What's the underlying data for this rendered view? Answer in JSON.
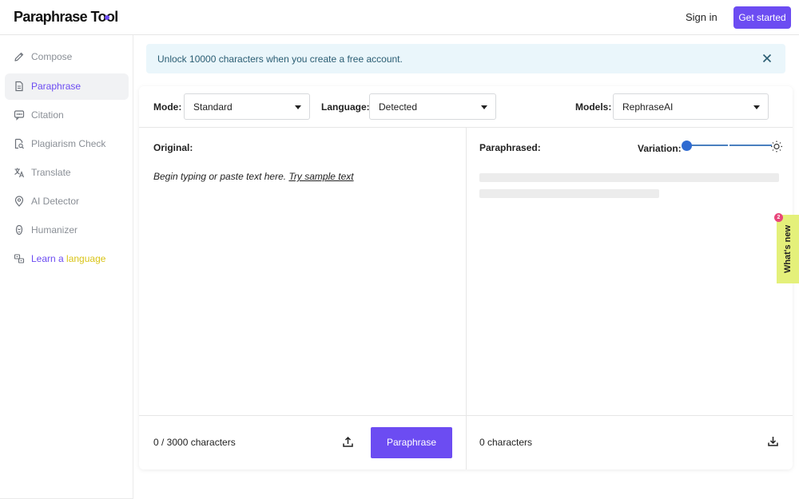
{
  "header": {
    "logo": "Paraphrase Tool",
    "sign_in": "Sign in",
    "get_started": "Get started"
  },
  "sidebar": {
    "items": [
      {
        "label": "Compose",
        "icon": "pencil-icon"
      },
      {
        "label": "Paraphrase",
        "icon": "document-icon",
        "active": true
      },
      {
        "label": "Citation",
        "icon": "quote-icon"
      },
      {
        "label": "Plagiarism Check",
        "icon": "document-search-icon"
      },
      {
        "label": "Translate",
        "icon": "translate-icon"
      },
      {
        "label": "AI Detector",
        "icon": "ai-detector-icon"
      },
      {
        "label": "Humanizer",
        "icon": "humanizer-icon"
      }
    ],
    "learn": {
      "part1": "Learn a ",
      "part2": "language",
      "icon": "language-icon"
    }
  },
  "banner": {
    "text": "Unlock 10000 characters when you create a free account."
  },
  "toolbar": {
    "mode_label": "Mode:",
    "mode_value": "Standard",
    "language_label": "Language:",
    "language_value": "Detected",
    "models_label": "Models:",
    "models_value": "RephraseAI"
  },
  "original": {
    "label": "Original:",
    "hint": "Begin typing or paste text here.",
    "sample_link": "Try sample text",
    "count": "0 / 3000 characters",
    "button": "Paraphrase"
  },
  "paraphrased": {
    "label": "Paraphrased:",
    "variation_label": "Variation:",
    "variation_level": 0,
    "count": "0 characters"
  },
  "whats_new": {
    "label": "What's new",
    "badge": "2"
  },
  "colors": {
    "accent": "#6c4cf2",
    "banner": "#eaf6fb",
    "whats_new": "#e4f07a"
  }
}
